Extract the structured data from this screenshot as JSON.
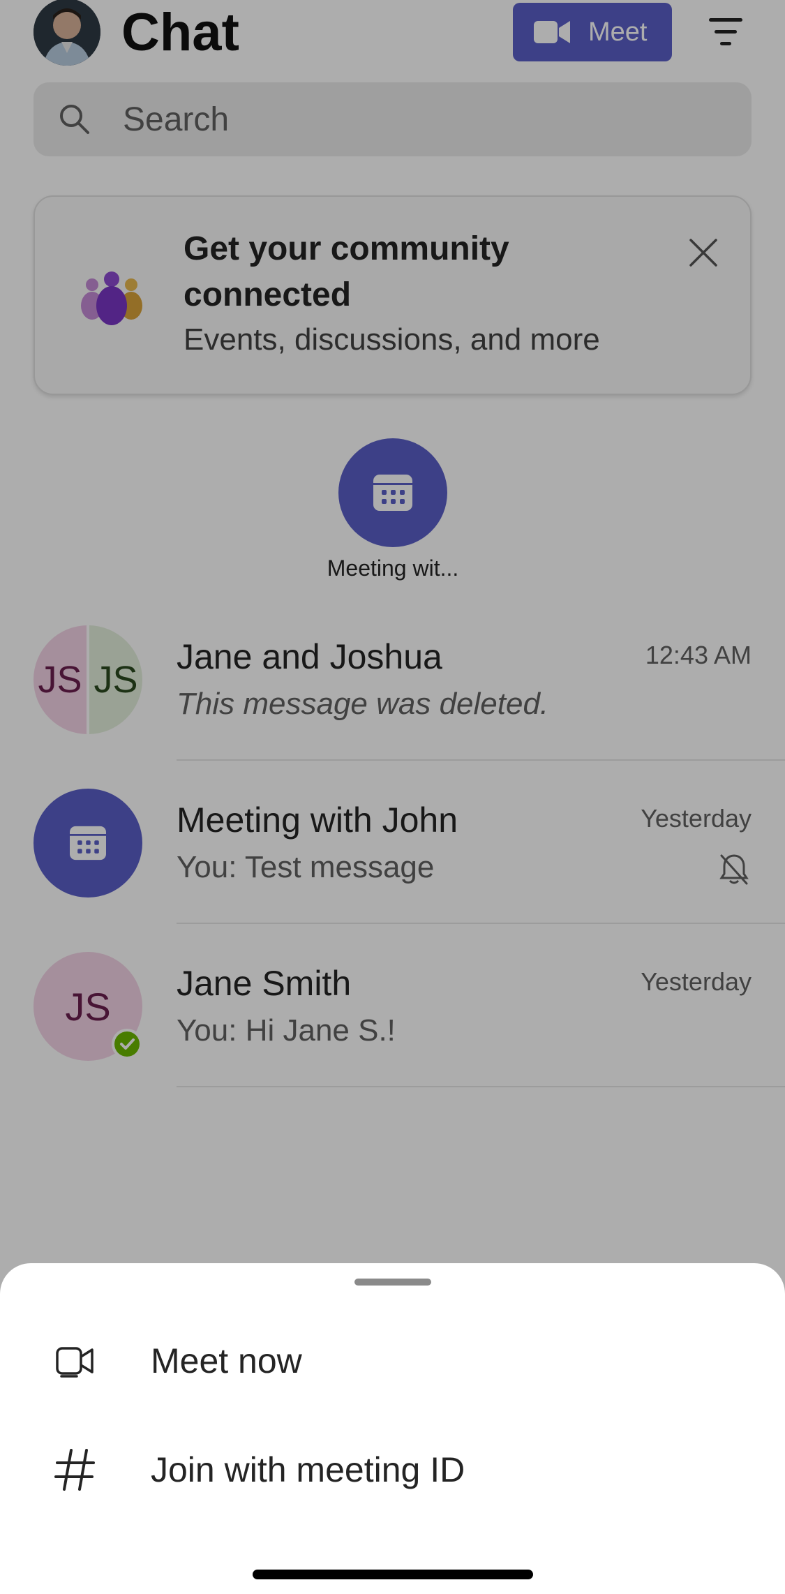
{
  "header": {
    "title": "Chat",
    "meet_label": "Meet"
  },
  "search": {
    "placeholder": "Search"
  },
  "banner": {
    "title": "Get your community connected",
    "subtitle": "Events, discussions, and more"
  },
  "pinned": {
    "label": "Meeting wit..."
  },
  "chats": [
    {
      "name": "Jane and Joshua",
      "message": "This message was deleted.",
      "time": "12:43 AM",
      "initials_left": "JS",
      "initials_right": "JS"
    },
    {
      "name": "Meeting with John",
      "message": "You: Test message",
      "time": "Yesterday"
    },
    {
      "name": "Jane Smith",
      "message": "You: Hi Jane S.!",
      "time": "Yesterday",
      "initials": "JS"
    }
  ],
  "sheet": {
    "items": [
      {
        "label": "Meet now",
        "icon": "video-camera-icon"
      },
      {
        "label": "Join with meeting ID",
        "icon": "hash-icon"
      }
    ]
  },
  "colors": {
    "accent": "#5b5fc7",
    "presence": "#6bb700",
    "avatar_pink": "#f3d3e6",
    "avatar_green": "#e3efdc"
  }
}
